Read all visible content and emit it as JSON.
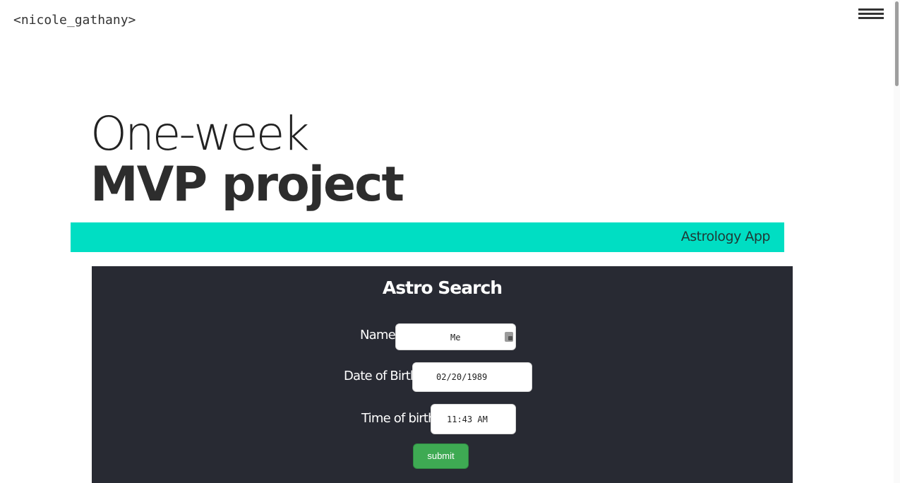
{
  "header": {
    "logo": "<nicole_gathany>",
    "menu_icon": "hamburger-menu-icon"
  },
  "hero": {
    "line1": "One-week",
    "line2": "MVP project"
  },
  "band": {
    "label": "Astrology App",
    "color": "#00dec3"
  },
  "screenshot": {
    "title": "Astro Search",
    "fields": {
      "name": {
        "label": "Name",
        "value": "Me"
      },
      "dob": {
        "label": "Date of Birth",
        "value": "02/20/1989"
      },
      "tob": {
        "label": "Time of birth",
        "value": "11:43 AM"
      }
    },
    "submit_label": "submit",
    "background": "#282a33",
    "button_color": "#3eaa53"
  }
}
